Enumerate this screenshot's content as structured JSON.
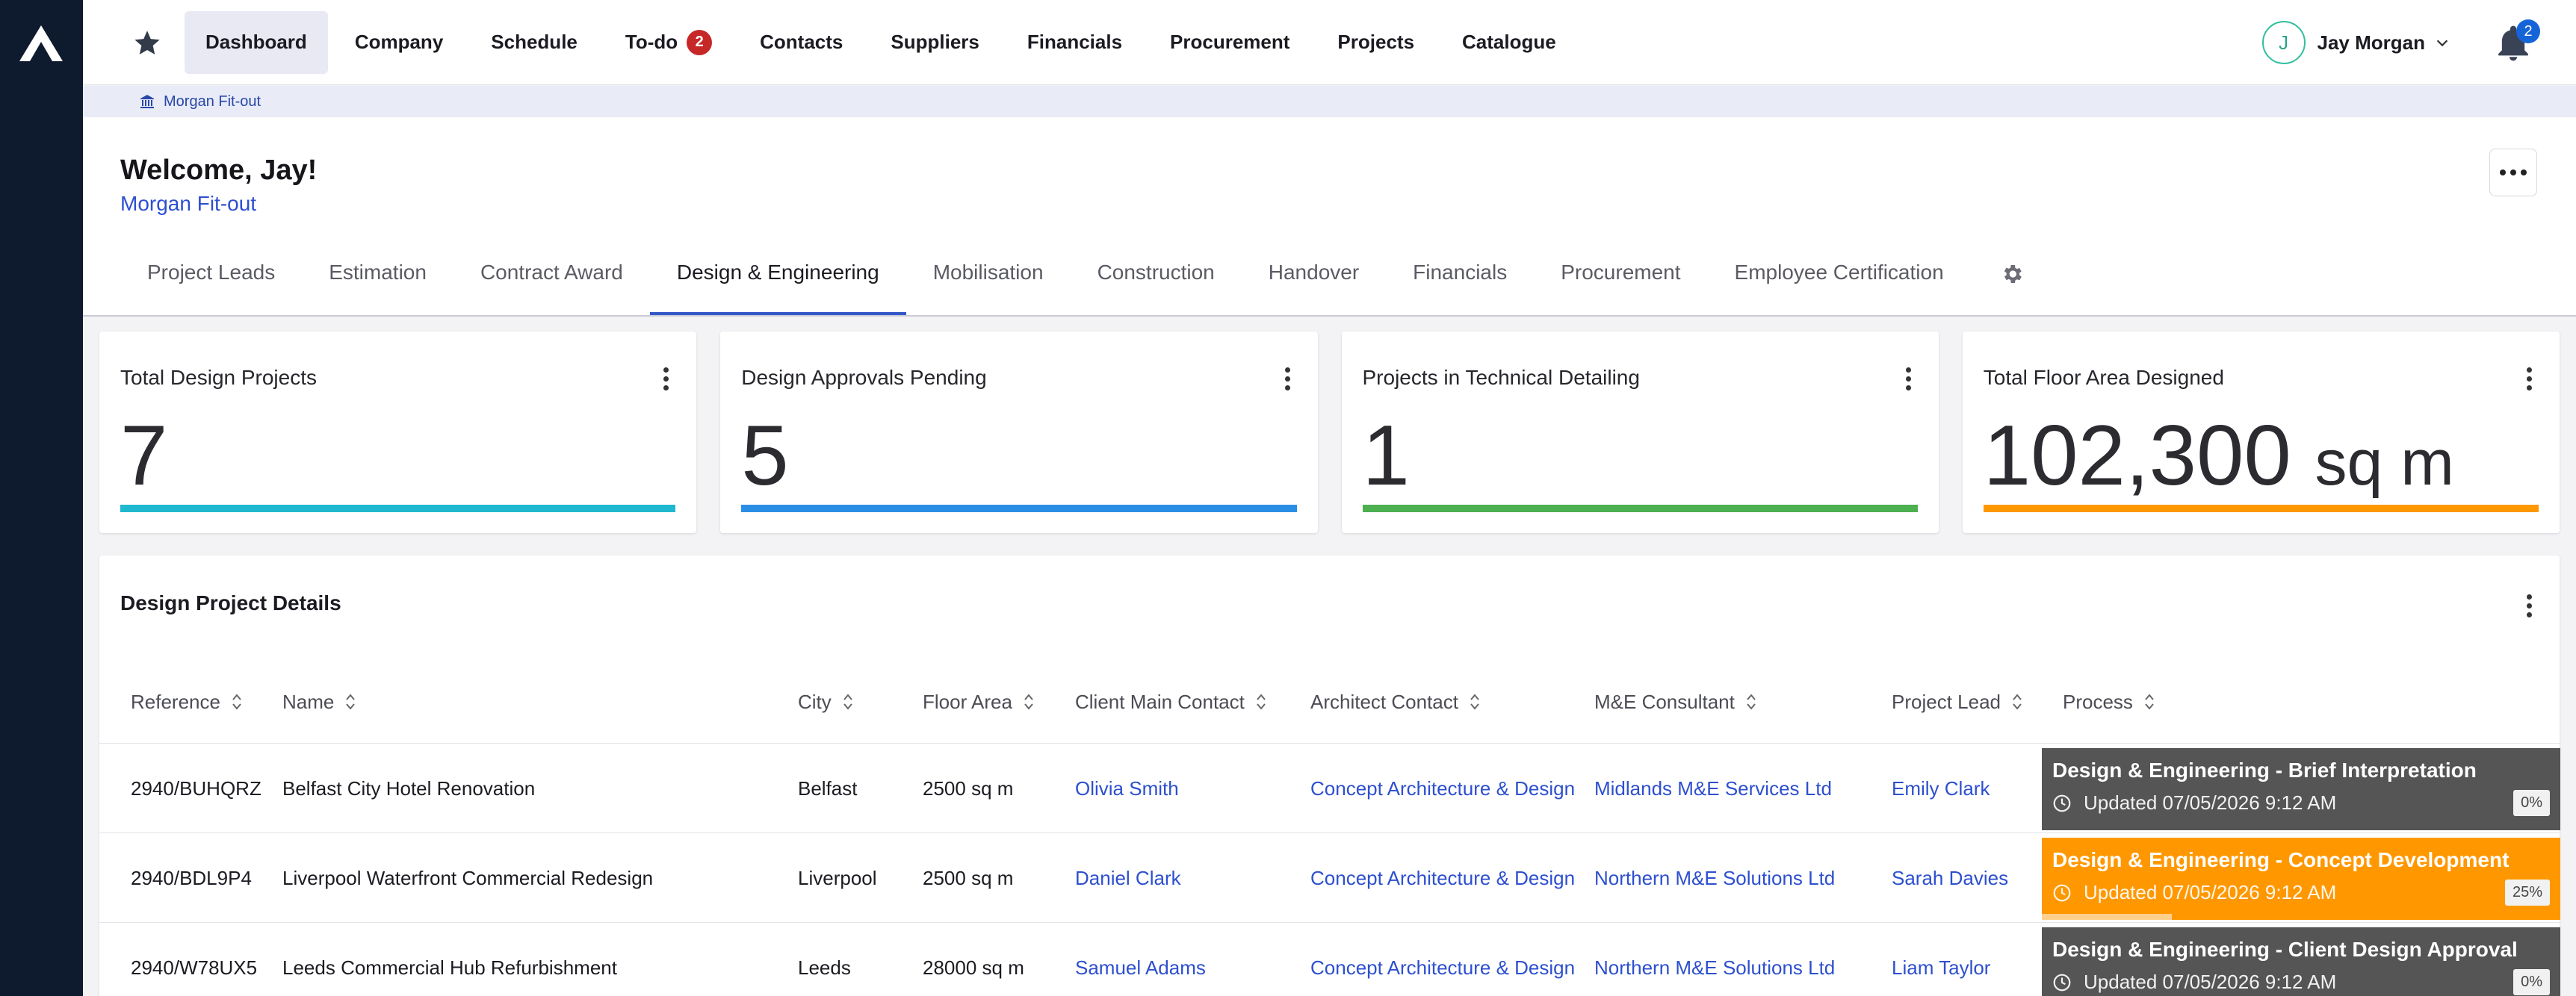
{
  "nav": {
    "items": [
      {
        "label": "Dashboard",
        "active": true
      },
      {
        "label": "Company"
      },
      {
        "label": "Schedule"
      },
      {
        "label": "To-do",
        "badge": "2"
      },
      {
        "label": "Contacts"
      },
      {
        "label": "Suppliers"
      },
      {
        "label": "Financials"
      },
      {
        "label": "Procurement"
      },
      {
        "label": "Projects"
      },
      {
        "label": "Catalogue"
      }
    ],
    "user_initial": "J",
    "user_name": "Jay Morgan",
    "notification_count": "2"
  },
  "breadcrumb": {
    "label": "Morgan Fit-out"
  },
  "header": {
    "welcome": "Welcome, Jay!",
    "company": "Morgan Fit-out"
  },
  "tabs": [
    {
      "label": "Project Leads"
    },
    {
      "label": "Estimation"
    },
    {
      "label": "Contract Award"
    },
    {
      "label": "Design & Engineering",
      "active": true
    },
    {
      "label": "Mobilisation"
    },
    {
      "label": "Construction"
    },
    {
      "label": "Handover"
    },
    {
      "label": "Financials"
    },
    {
      "label": "Procurement"
    },
    {
      "label": "Employee Certification"
    }
  ],
  "cards": [
    {
      "title": "Total Design Projects",
      "value": "7",
      "unit": "",
      "color": "#1fb8cf"
    },
    {
      "title": "Design Approvals Pending",
      "value": "5",
      "unit": "",
      "color": "#2b8ee6"
    },
    {
      "title": "Projects in Technical Detailing",
      "value": "1",
      "unit": "",
      "color": "#4caf50"
    },
    {
      "title": "Total Floor Area Designed",
      "value": "102,300",
      "unit": "sq m",
      "color": "#ff9800"
    }
  ],
  "table": {
    "title": "Design Project Details",
    "columns": [
      "Reference",
      "Name",
      "City",
      "Floor Area",
      "Client Main Contact",
      "Architect Contact",
      "M&E Consultant",
      "Project Lead",
      "Process"
    ],
    "rows": [
      {
        "reference": "2940/BUHQRZ",
        "name": "Belfast City Hotel Renovation",
        "city": "Belfast",
        "floor_area": "2500 sq m",
        "client_contact": "Olivia Smith",
        "architect": "Concept Architecture & Design",
        "consultant": "Midlands M&E Services Ltd",
        "lead": "Emily Clark",
        "process_title": "Design & Engineering - Brief Interpretation",
        "process_updated": "Updated 07/05/2026 9:12 AM",
        "process_pct": "0%",
        "progress": 0,
        "process_color": "#555555"
      },
      {
        "reference": "2940/BDL9P4",
        "name": "Liverpool Waterfront Commercial Redesign",
        "city": "Liverpool",
        "floor_area": "2500 sq m",
        "client_contact": "Daniel Clark",
        "architect": "Concept Architecture & Design",
        "consultant": "Northern M&E Solutions Ltd",
        "lead": "Sarah Davies",
        "process_title": "Design & Engineering - Concept Development",
        "process_updated": "Updated 07/05/2026 9:12 AM",
        "process_pct": "25%",
        "progress": 0.25,
        "process_color": "#ff9800"
      },
      {
        "reference": "2940/W78UX5",
        "name": "Leeds Commercial Hub Refurbishment",
        "city": "Leeds",
        "floor_area": "28000 sq m",
        "client_contact": "Samuel Adams",
        "architect": "Concept Architecture & Design",
        "consultant": "Northern M&E Solutions Ltd",
        "lead": "Liam Taylor",
        "process_title": "Design & Engineering - Client Design Approval",
        "process_updated": "Updated 07/05/2026 9:12 AM",
        "process_pct": "0%",
        "progress": 0,
        "process_color": "#555555"
      }
    ]
  }
}
